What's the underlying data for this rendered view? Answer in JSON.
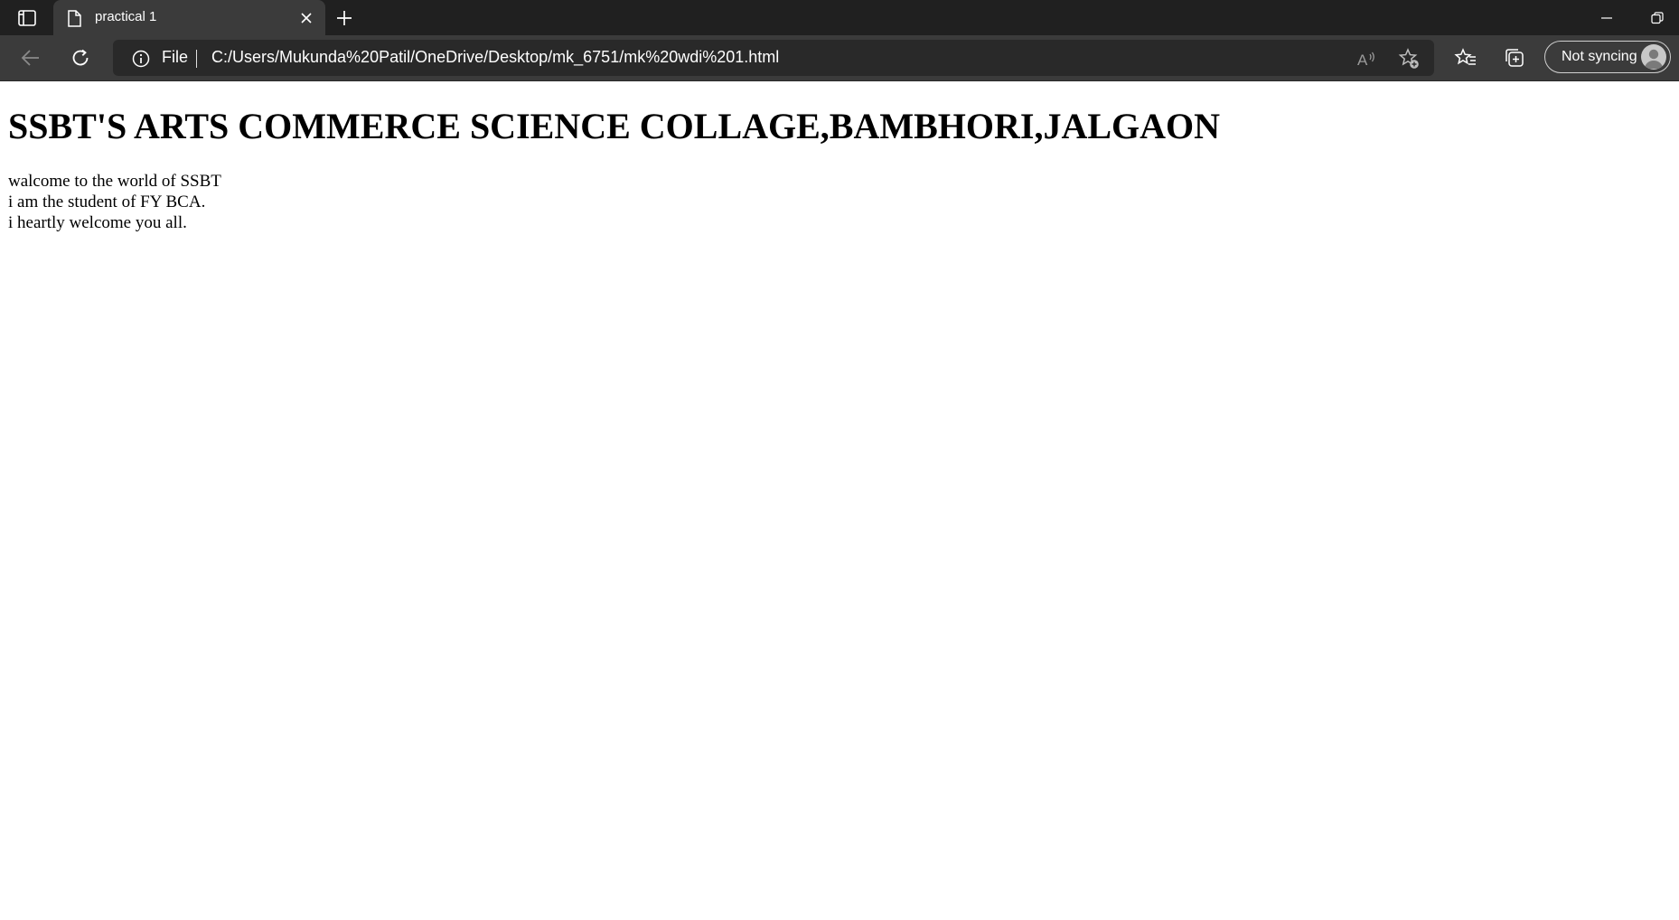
{
  "browser": {
    "tab": {
      "title": "practical 1"
    },
    "address_bar": {
      "scheme_label": "File",
      "url": "C:/Users/Mukunda%20Patil/OneDrive/Desktop/mk_6751/mk%20wdi%201.html"
    },
    "profile": {
      "status": "Not syncing"
    },
    "icons": {
      "tab_actions": "tab-actions-icon",
      "favicon": "document-icon",
      "tab_close": "close-icon",
      "new_tab": "plus-icon",
      "minimize": "minimize-icon",
      "restore": "restore-icon",
      "back": "back-arrow-icon",
      "refresh": "refresh-icon",
      "site_info": "info-icon",
      "read_aloud": "read-aloud-icon",
      "add_favorite": "star-add-icon",
      "favorites": "favorites-icon",
      "collections": "collections-icon",
      "avatar": "user-avatar-icon"
    },
    "colors": {
      "tabstrip": "#202020",
      "toolbar": "#3b3b3b",
      "omnibox": "#292929",
      "page_background": "#ffffff"
    }
  },
  "page": {
    "heading": "SSBT'S ARTS COMMERCE SCIENCE COLLAGE,BAMBHORI,JALGAON",
    "lines": [
      "walcome to the world of SSBT",
      "i am the student of FY BCA.",
      "i heartly welcome you all."
    ]
  }
}
